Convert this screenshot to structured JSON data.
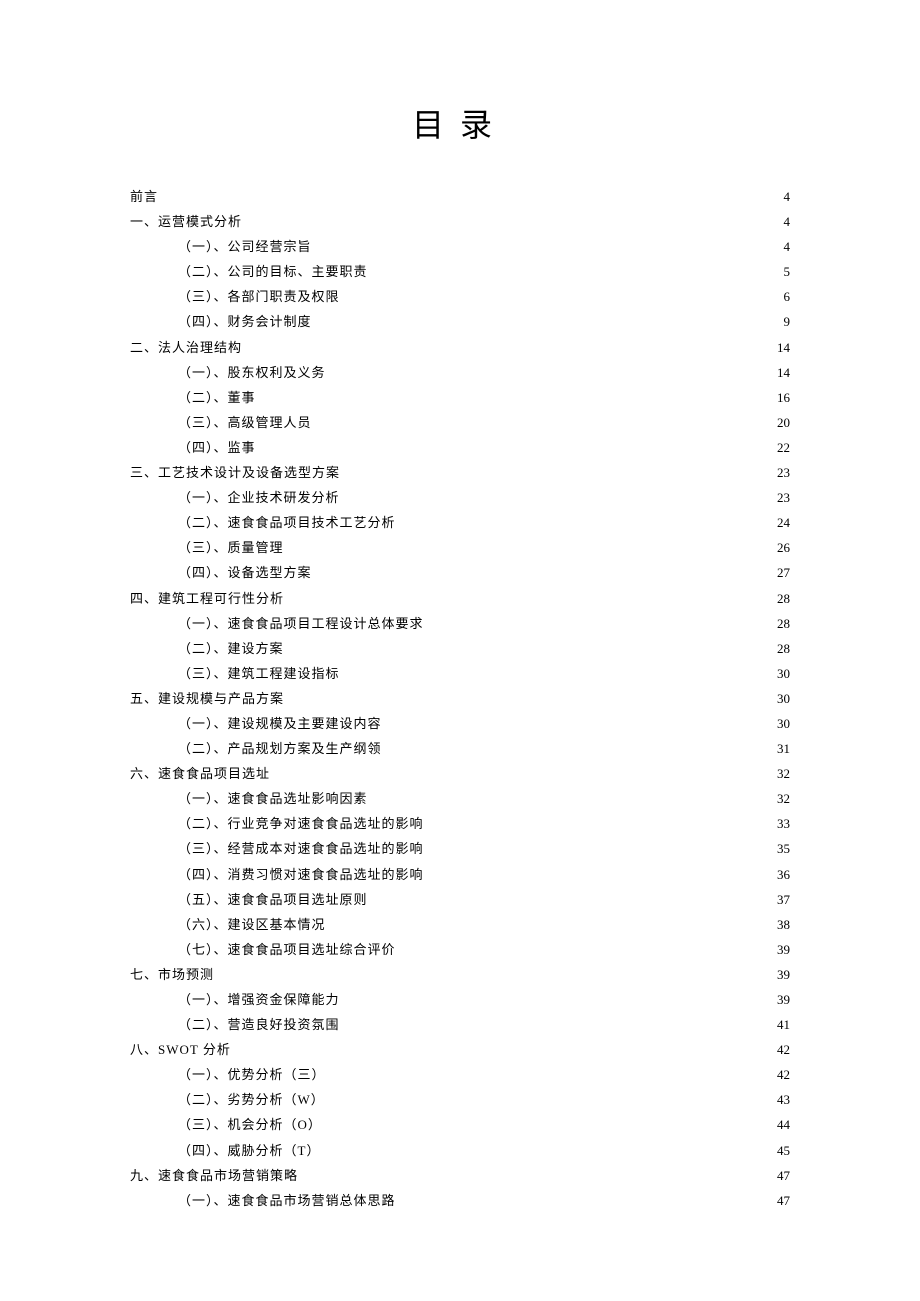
{
  "title": "目录",
  "toc": [
    {
      "level": 1,
      "label": "前言",
      "page": "4"
    },
    {
      "level": 1,
      "label": "一、运营模式分析",
      "page": "4"
    },
    {
      "level": 2,
      "label": "（一）、公司经营宗旨",
      "page": "4"
    },
    {
      "level": 2,
      "label": "（二）、公司的目标、主要职责",
      "page": "5"
    },
    {
      "level": 2,
      "label": "（三）、各部门职责及权限",
      "page": "6"
    },
    {
      "level": 2,
      "label": "（四）、财务会计制度",
      "page": "9"
    },
    {
      "level": 1,
      "label": "二、法人治理结构",
      "page": "14"
    },
    {
      "level": 2,
      "label": "（一）、股东权利及义务",
      "page": "14"
    },
    {
      "level": 2,
      "label": "（二）、董事",
      "page": "16"
    },
    {
      "level": 2,
      "label": "（三）、高级管理人员",
      "page": "20"
    },
    {
      "level": 2,
      "label": "（四）、监事",
      "page": "22"
    },
    {
      "level": 1,
      "label": "三、工艺技术设计及设备选型方案",
      "page": "23"
    },
    {
      "level": 2,
      "label": "（一）、企业技术研发分析",
      "page": "23"
    },
    {
      "level": 2,
      "label": "（二）、速食食品项目技术工艺分析",
      "page": "24"
    },
    {
      "level": 2,
      "label": "（三）、质量管理",
      "page": "26"
    },
    {
      "level": 2,
      "label": "（四）、设备选型方案",
      "page": "27"
    },
    {
      "level": 1,
      "label": "四、建筑工程可行性分析",
      "page": "28"
    },
    {
      "level": 2,
      "label": "（一）、速食食品项目工程设计总体要求",
      "page": "28"
    },
    {
      "level": 2,
      "label": "（二）、建设方案",
      "page": "28"
    },
    {
      "level": 2,
      "label": "（三）、建筑工程建设指标",
      "page": "30"
    },
    {
      "level": 1,
      "label": "五、建设规模与产品方案",
      "page": "30"
    },
    {
      "level": 2,
      "label": "（一）、建设规模及主要建设内容",
      "page": "30"
    },
    {
      "level": 2,
      "label": "（二）、产品规划方案及生产纲领",
      "page": "31"
    },
    {
      "level": 1,
      "label": "六、速食食品项目选址",
      "page": "32"
    },
    {
      "level": 2,
      "label": "（一）、速食食品选址影响因素",
      "page": "32"
    },
    {
      "level": 2,
      "label": "（二）、行业竞争对速食食品选址的影响",
      "page": "33"
    },
    {
      "level": 2,
      "label": "（三）、经营成本对速食食品选址的影响",
      "page": "35"
    },
    {
      "level": 2,
      "label": "（四）、消费习惯对速食食品选址的影响",
      "page": "36"
    },
    {
      "level": 2,
      "label": "（五）、速食食品项目选址原则",
      "page": "37"
    },
    {
      "level": 2,
      "label": "（六）、建设区基本情况",
      "page": "38"
    },
    {
      "level": 2,
      "label": "（七）、速食食品项目选址综合评价",
      "page": "39"
    },
    {
      "level": 1,
      "label": "七、市场预测",
      "page": "39"
    },
    {
      "level": 2,
      "label": "（一）、增强资金保障能力",
      "page": "39"
    },
    {
      "level": 2,
      "label": "（二）、营造良好投资氛围",
      "page": "41"
    },
    {
      "level": 1,
      "label": "八、SWOT 分析",
      "page": "42"
    },
    {
      "level": 2,
      "label": "（一）、优势分析（三）",
      "page": "42"
    },
    {
      "level": 2,
      "label": "（二）、劣势分析（W）",
      "page": "43"
    },
    {
      "level": 2,
      "label": "（三）、机会分析（O）",
      "page": "44"
    },
    {
      "level": 2,
      "label": "（四）、威胁分析（T）",
      "page": "45"
    },
    {
      "level": 1,
      "label": "九、速食食品市场营销策略",
      "page": "47"
    },
    {
      "level": 2,
      "label": "（一）、速食食品市场营销总体思路",
      "page": "47"
    }
  ]
}
